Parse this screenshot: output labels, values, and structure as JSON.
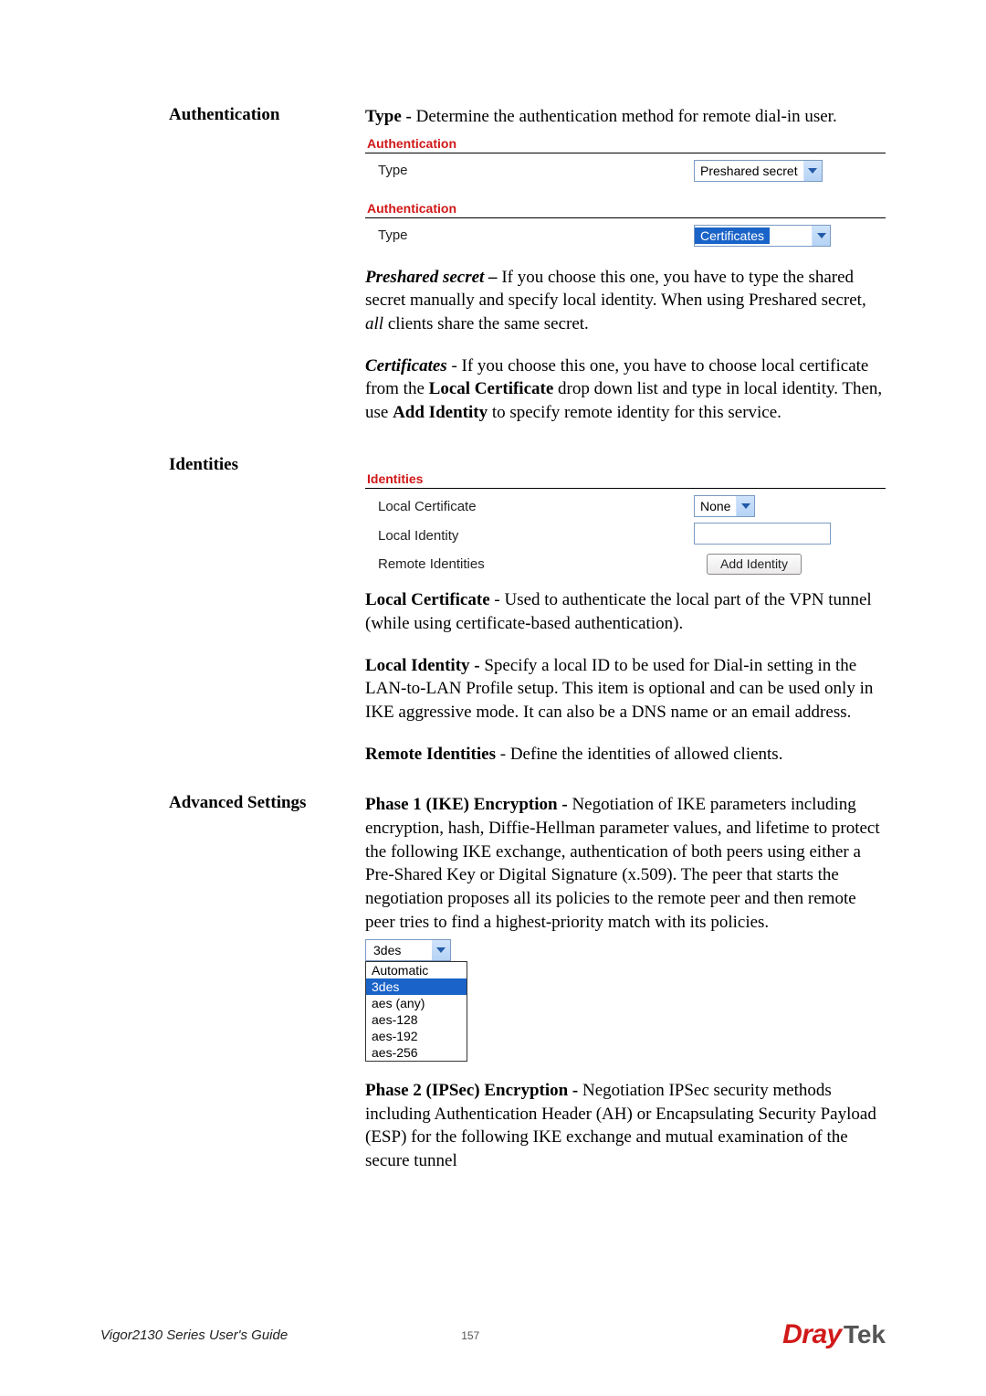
{
  "sections": {
    "auth": {
      "label": "Authentication",
      "type_intro_bold": "Type - ",
      "type_intro_rest": "Determine the authentication method for remote dial-in user.",
      "ui1": {
        "header": "Authentication",
        "row_label": "Type",
        "select_value": "Preshared secret"
      },
      "ui2": {
        "header": "Authentication",
        "row_label": "Type",
        "select_value": "Certificates"
      },
      "preshared_title": "Preshared secret – ",
      "preshared_body_a": "If you choose this one, you have to type the shared secret manually and specify local identity. When using Preshared secret, ",
      "preshared_body_b": "all",
      "preshared_body_c": " clients share the same secret.",
      "cert_title": "Certificates",
      "cert_body_a": " - If you choose this one, you have to choose local certificate from the ",
      "cert_body_b": "Local Certificate",
      "cert_body_c": " drop down list and type in local identity. Then, use ",
      "cert_body_d": "Add Identity",
      "cert_body_e": " to specify remote identity for this service."
    },
    "identities": {
      "label": "Identities",
      "ui": {
        "header": "Identities",
        "local_cert_label": "Local Certificate",
        "local_cert_value": "None",
        "local_identity_label": "Local Identity",
        "remote_identities_label": "Remote Identities",
        "add_identity_btn": "Add Identity"
      },
      "lc_title": "Local Certificate",
      "lc_body": "    - Used to authenticate the local part of the VPN tunnel (while using certificate-based authentication).",
      "li_title": "Local Identity - ",
      "li_body": "Specify a local ID to be used for Dial-in setting in the LAN-to-LAN Profile setup. This item is optional and can be used only in IKE aggressive mode. It can also be a DNS name or an email address.",
      "ri_title": "Remote Identities",
      "ri_body": " - Define the identities of allowed clients."
    },
    "advanced": {
      "label": "Advanced Settings",
      "p1_title": "Phase 1 (IKE) Encryption - ",
      "p1_body": "Negotiation of IKE parameters including encryption, hash, Diffie-Hellman parameter values, and lifetime to protect the following IKE exchange, authentication of both peers using either a Pre-Shared Key or Digital Signature (x.509). The peer that starts the negotiation proposes all its policies to the remote peer and then remote peer tries to find a highest-priority match with its policies.",
      "enc_selected": "3des",
      "enc_options": [
        "Automatic",
        "3des",
        "aes (any)",
        "aes-128",
        "aes-192",
        "aes-256"
      ],
      "p2_title": "Phase 2 (IPSec) Encryption - ",
      "p2_body": "Negotiation IPSec security methods including Authentication Header (AH) or Encapsulating Security Payload (ESP) for the following IKE exchange and mutual examination of the secure tunnel"
    }
  },
  "footer": {
    "guide": "Vigor2130 Series User's Guide",
    "page": "157",
    "logo_a": "Dray",
    "logo_b": "Tek"
  }
}
